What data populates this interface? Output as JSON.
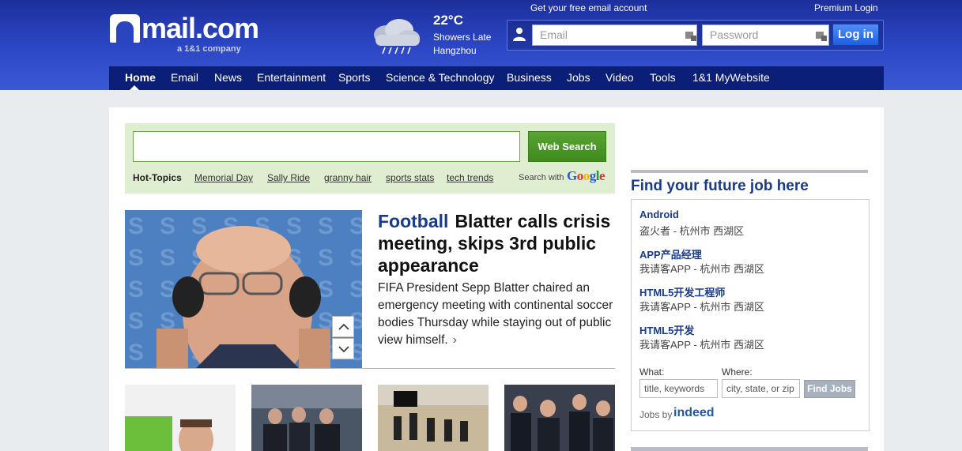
{
  "header": {
    "logo_text": "mail.com",
    "logo_subtitle": "a 1&1 company",
    "weather": {
      "temperature": "22°C",
      "description": "Showers Late",
      "city": "Hangzhou"
    },
    "free_account_link": "Get your free email account",
    "premium_login_link": "Premium Login",
    "email_placeholder": "Email",
    "password_placeholder": "Password",
    "login_button": "Log in"
  },
  "nav": {
    "items": [
      {
        "label": "Home"
      },
      {
        "label": "Email"
      },
      {
        "label": "News"
      },
      {
        "label": "Entertainment"
      },
      {
        "label": "Sports"
      },
      {
        "label": "Science & Technology"
      },
      {
        "label": "Business"
      },
      {
        "label": "Jobs"
      },
      {
        "label": "Video"
      },
      {
        "label": "Tools"
      },
      {
        "label": "1&1 MyWebsite"
      }
    ]
  },
  "search": {
    "button_label": "Web Search",
    "hot_topics_label": "Hot-Topics",
    "hot_topics": [
      "Memorial Day",
      "Sally Ride",
      "granny hair",
      "sports stats",
      "tech trends"
    ],
    "search_with_label": "Search with",
    "provider": "Google"
  },
  "hero": {
    "category": "Football",
    "headline": "Blatter calls crisis meeting, skips 3rd public appearance",
    "teaser": "FIFA President Sepp Blatter chaired an emergency meeting with continental soccer bodies Thursday while staying out of public view himself.",
    "more_arrow": "›"
  },
  "jobs": {
    "title": "Find your future job here",
    "listings": [
      {
        "title": "Android",
        "sub": "盗火者 - 杭州市 西湖区"
      },
      {
        "title": "APP产品经理",
        "sub": "我请客APP - 杭州市 西湖区"
      },
      {
        "title": "HTML5开发工程师",
        "sub": "我请客APP - 杭州市 西湖区"
      },
      {
        "title": "HTML5开发",
        "sub": "我请客APP - 杭州市 西湖区"
      }
    ],
    "what_label": "What:",
    "where_label": "Where:",
    "what_placeholder": "title, keywords",
    "where_placeholder": "city, state, or zip",
    "find_button": "Find Jobs",
    "jobs_by_label": "Jobs by",
    "jobs_by_brand": "indeed"
  },
  "colors": {
    "header_blue": "#2d48c7",
    "nav_dark": "#0b1e78",
    "search_green": "#4a9628",
    "link_blue": "#1a3a8a"
  }
}
